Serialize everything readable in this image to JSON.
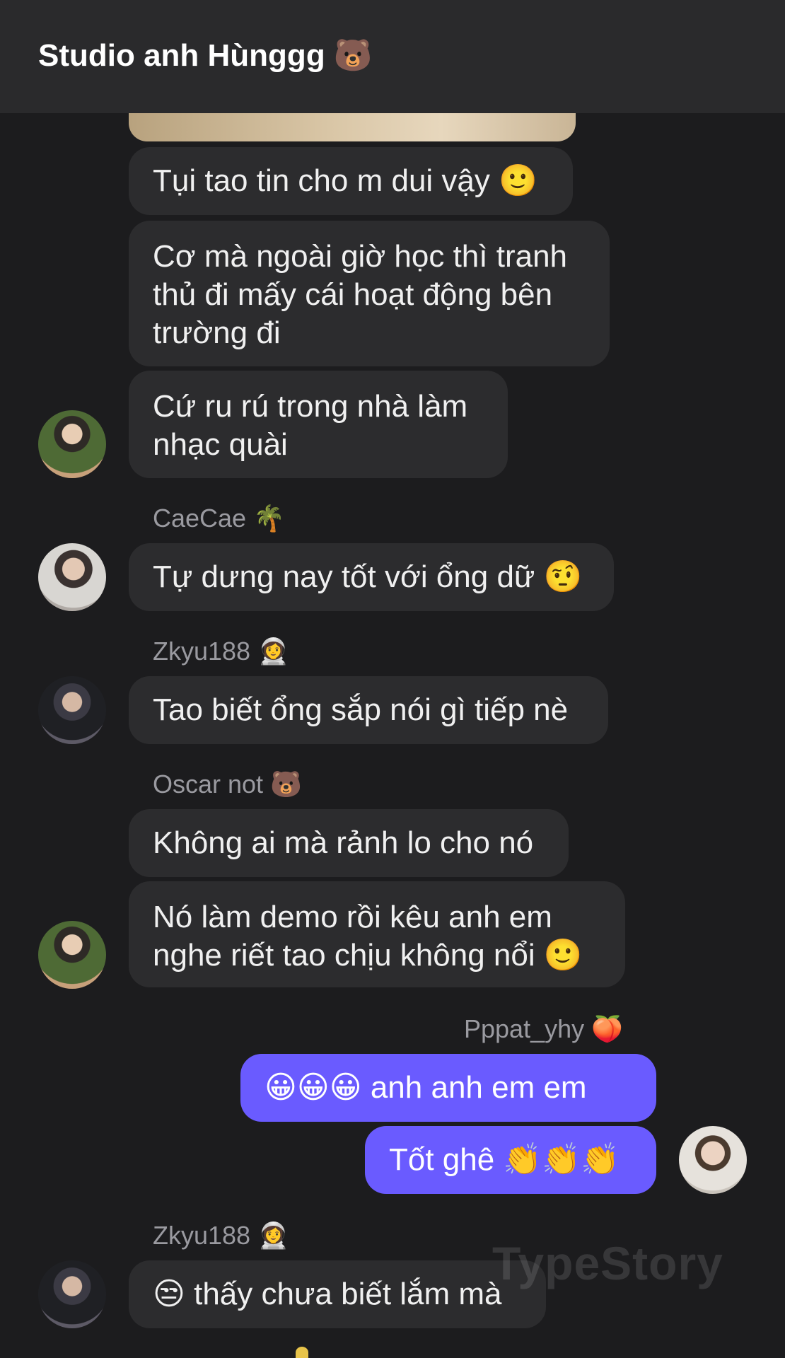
{
  "header": {
    "title": "Studio anh Hùnggg 🐻"
  },
  "messages": [
    {
      "text": "Tụi tao tin cho m dui vậy 🙂"
    },
    {
      "text": "Cơ mà ngoài giờ học thì tranh\nthủ đi mấy cái hoạt động bên\ntrường đi"
    },
    {
      "text": "Cứ ru rú trong nhà làm\nnhạc quài"
    },
    {
      "sender": "CaeCae 🌴",
      "text": "Tự dưng nay tốt với ổng dữ 🤨"
    },
    {
      "sender": "Zkyu188 👩‍🚀",
      "text": "Tao biết ổng sắp nói gì tiếp nè"
    },
    {
      "sender": "Oscar not 🐻",
      "text": "Không ai mà rảnh lo cho nó"
    },
    {
      "text": "Nó làm demo rồi kêu anh em\nnghe riết tao chịu không nổi 🙂"
    },
    {
      "sender": "Pppat_yhy 🍑",
      "text": "😀😀😀 anh anh em em"
    },
    {
      "text": "Tốt ghê 👏👏👏"
    },
    {
      "sender": "Zkyu188 👩‍🚀",
      "text": "😒 thấy chưa biết lắm mà"
    }
  ],
  "watermark": "TypeStory",
  "colors": {
    "background": "#1c1c1e",
    "header": "#2a2a2c",
    "bubble": "#2c2c2e",
    "mine_bubble": "#6a5bff"
  }
}
